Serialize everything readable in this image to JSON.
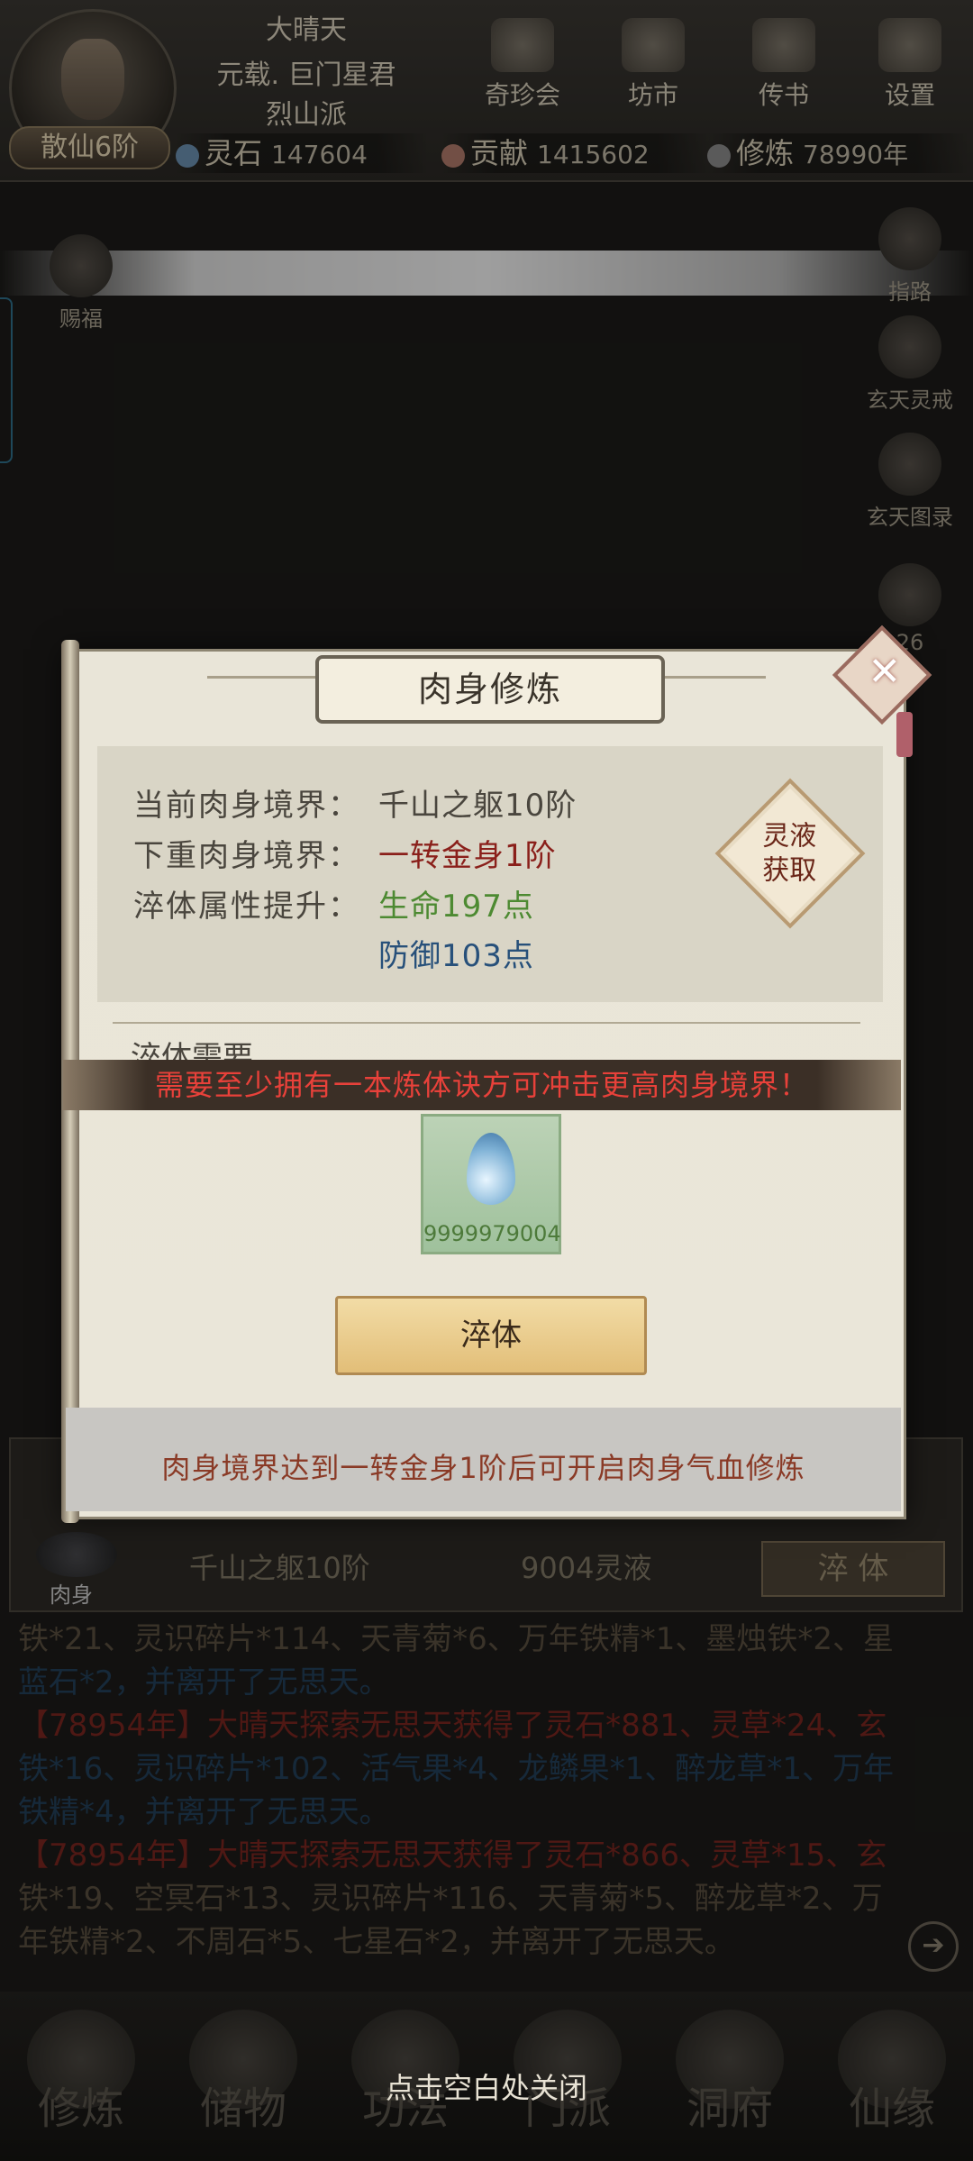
{
  "header": {
    "player_name": "大晴天",
    "title_line": "元载. 巨门星君",
    "sect": "烈山派",
    "realm_badge": "散仙6阶",
    "menu": [
      {
        "label": "奇珍会",
        "icon": "treasure-icon"
      },
      {
        "label": "坊市",
        "icon": "market-icon"
      },
      {
        "label": "传书",
        "icon": "letter-icon"
      },
      {
        "label": "设置",
        "icon": "gear-icon"
      }
    ],
    "resources": [
      {
        "label": "灵石",
        "value": "147604",
        "icon": "spirit-stone-icon",
        "color": "#6b8fb0"
      },
      {
        "label": "贡献",
        "value": "1415602",
        "icon": "contribution-icon",
        "color": "#b07a6a"
      },
      {
        "label": "修炼",
        "value": "78990年",
        "icon": "cultivation-icon",
        "color": "#8a8a8a"
      }
    ]
  },
  "side_menu": {
    "left_item": "赐福",
    "right_items": [
      {
        "label": "指路"
      },
      {
        "label": "玄天灵戒"
      },
      {
        "label": "玄天图录"
      },
      {
        "label": "26"
      }
    ]
  },
  "modal": {
    "title": "肉身修炼",
    "rows": [
      {
        "label": "当前肉身境界：",
        "value": "千山之躯10阶"
      },
      {
        "label": "下重肉身境界：",
        "value": "一转金身1阶"
      },
      {
        "label": "淬体属性提升：",
        "value": "生命197点"
      }
    ],
    "extra_value": "防御103点",
    "side_button": [
      "灵液",
      "获取"
    ],
    "section_label": "淬体需要",
    "warning": "需要至少拥有一本炼体诀方可冲击更高肉身境界！",
    "item_count": "9999979004",
    "action_button": "淬体",
    "footer": "肉身境界达到一转金身1阶后可开启肉身气血修炼"
  },
  "body_panel": {
    "icon_label": "肉身",
    "realm": "千山之躯10阶",
    "cost": "9004灵液",
    "button": "淬 体"
  },
  "log": {
    "line1": "铁*21、灵识碎片*114、天青菊*6、万年铁精*1、墨烛铁*2、星",
    "line2": "蓝石*2，并离开了无思天。",
    "line3": "【78954年】大晴天探索无思天获得了灵石*881、灵草*24、玄",
    "line4": "铁*16、灵识碎片*102、活气果*4、龙鳞果*1、醉龙草*1、万年",
    "line5": "铁精*4，并离开了无思天。",
    "line6": "【78954年】大晴天探索无思天获得了灵石*866、灵草*15、玄",
    "line7": "铁*19、空冥石*13、灵识碎片*116、天青菊*5、醉龙草*2、万",
    "line8": "年铁精*2、不周石*5、七星石*2，并离开了无思天。"
  },
  "bottom_nav": [
    {
      "label": "修炼",
      "icon": "cultivate-icon"
    },
    {
      "label": "储物",
      "icon": "storage-icon"
    },
    {
      "label": "功法",
      "icon": "technique-icon"
    },
    {
      "label": "门派",
      "icon": "sect-icon"
    },
    {
      "label": "洞府",
      "icon": "cave-icon"
    },
    {
      "label": "仙缘",
      "icon": "fate-icon"
    }
  ],
  "close_hint": "点击空白处关闭"
}
